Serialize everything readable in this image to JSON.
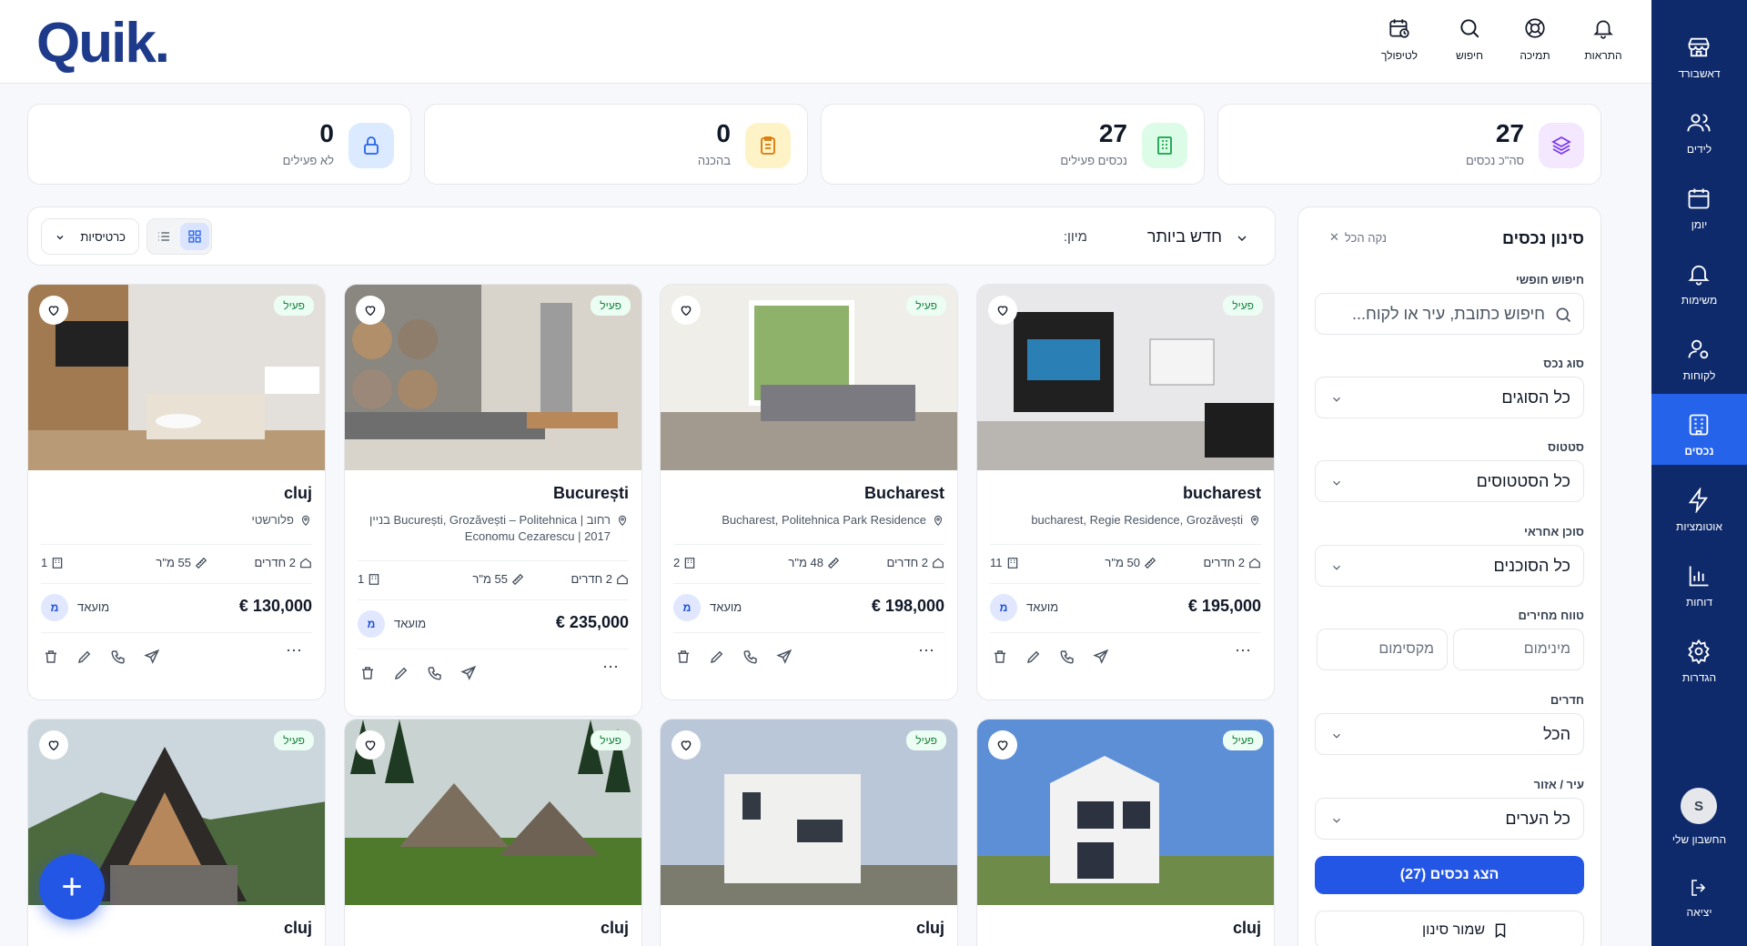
{
  "brand": {
    "logo": "Quik."
  },
  "nav": {
    "items": [
      {
        "label": "דאשבורד",
        "icon": "store-icon"
      },
      {
        "label": "לידים",
        "icon": "users-icon"
      },
      {
        "label": "יומן",
        "icon": "calendar-icon"
      },
      {
        "label": "משימות",
        "icon": "bell-icon"
      },
      {
        "label": "לקוחות",
        "icon": "user-gear-icon"
      },
      {
        "label": "נכסים",
        "icon": "building-icon",
        "active": true
      },
      {
        "label": "אוטומציות",
        "icon": "lightning-icon"
      },
      {
        "label": "דוחות",
        "icon": "bar-chart-icon"
      },
      {
        "label": "הגדרות",
        "icon": "gear-icon"
      }
    ],
    "account": {
      "initial": "S",
      "label": "החשבון שלי"
    },
    "logout": "יציאה"
  },
  "topbar": {
    "alerts": "התראות",
    "support": "תמיכה",
    "search": "חיפוש",
    "followup": "לטיפולך"
  },
  "stats": [
    {
      "value": "27",
      "label": "סה\"כ נכסים",
      "icon": "layers-icon",
      "color": "#7c3aed",
      "bg": "#f3e8ff"
    },
    {
      "value": "27",
      "label": "נכסים פעילים",
      "icon": "building-icon",
      "color": "#16a34a",
      "bg": "#dcfce7"
    },
    {
      "value": "0",
      "label": "בהכנה",
      "icon": "clipboard-icon",
      "color": "#d97706",
      "bg": "#fef3c7"
    },
    {
      "value": "0",
      "label": "לא פעילים",
      "icon": "lock-icon",
      "color": "#2563eb",
      "bg": "#dbeafe"
    }
  ],
  "toolbar": {
    "sort_label": "מיון:",
    "sort_value": "חדש ביותר",
    "type_value": "כרטיסיות"
  },
  "filter": {
    "title": "סינון נכסים",
    "clear": "נקה הכל",
    "free_search_label": "חיפוש חופשי",
    "free_search_placeholder": "חיפוש כתובת, עיר או לקוח...",
    "type_label": "סוג נכס",
    "type_value": "כל הסוגים",
    "status_label": "סטטוס",
    "status_value": "כל הסטטוסים",
    "agent_label": "סוכן אחראי",
    "agent_value": "כל הסוכנים",
    "price_label": "טווח מחירים",
    "price_min": "מינימום",
    "price_max": "מקסימום",
    "rooms_label": "חדרים",
    "rooms_value": "הכל",
    "city_label": "עיר / אזור",
    "city_value": "כל הערים",
    "apply": "הצג נכסים (27)",
    "save": "שמור סינון"
  },
  "cards": [
    {
      "status": "פעיל",
      "title": "bucharest",
      "address": "bucharest, Regie Residence, Grozăvești",
      "rooms": "2 חדרים",
      "area": "50 מ\"ר",
      "floor": "11",
      "price": "€ 195,000",
      "agent": "מועאד",
      "agent_initial": "מ"
    },
    {
      "status": "פעיל",
      "title": "Bucharest",
      "address": "Bucharest, Politehnica Park Residence",
      "rooms": "2 חדרים",
      "area": "48 מ\"ר",
      "floor": "2",
      "price": "€ 198,000",
      "agent": "מועאד",
      "agent_initial": "מ"
    },
    {
      "status": "פעיל",
      "title": "București",
      "address": "רחוב | București, Grozăvești – Politehnica בניין 2017 | Economu Cezarescu",
      "rooms": "2 חדרים",
      "area": "55 מ\"ר",
      "floor": "1",
      "price": "€ 235,000",
      "agent": "מועאד",
      "agent_initial": "מ"
    },
    {
      "status": "פעיל",
      "title": "cluj",
      "address": "פלורשטי",
      "rooms": "2 חדרים",
      "area": "55 מ\"ר",
      "floor": "1",
      "price": "€ 130,000",
      "agent": "מועאד",
      "agent_initial": "מ"
    },
    {
      "status": "פעיל",
      "title": "cluj"
    },
    {
      "status": "פעיל",
      "title": "cluj"
    },
    {
      "status": "פעיל",
      "title": "cluj"
    },
    {
      "status": "פעיל",
      "title": "cluj"
    }
  ],
  "colors": {
    "nav_bg": "#0e2a6b",
    "accent": "#2456e5",
    "active_badge": "#15803d"
  }
}
